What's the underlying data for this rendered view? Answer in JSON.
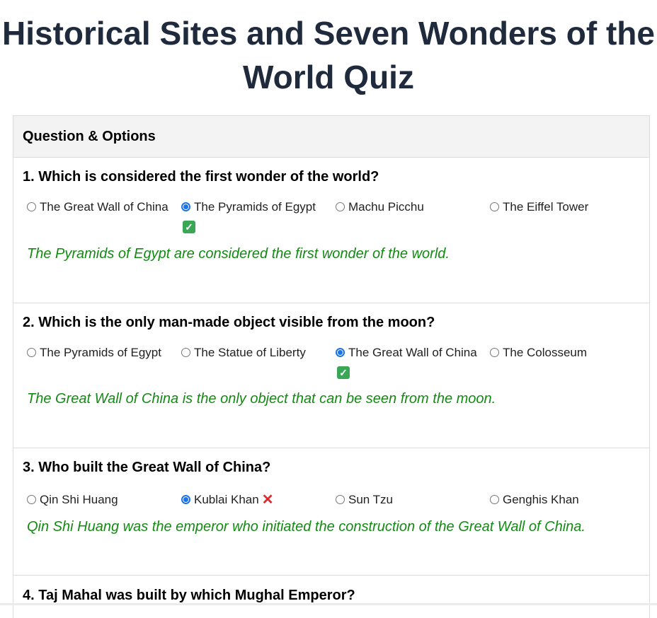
{
  "title": "Historical Sites and Seven Wonders of the World Quiz",
  "table": {
    "header": "Question & Options"
  },
  "questions": [
    {
      "text": "1. Which is considered the first wonder of the world?",
      "options": [
        "The Great Wall of China",
        "The Pyramids of Egypt",
        "Machu Picchu",
        "The Eiffel Tower"
      ],
      "selected": 1,
      "result_mark": "✅",
      "explanation": "The Pyramids of Egypt are considered the first wonder of the world."
    },
    {
      "text": "2. Which is the only man-made object visible from the moon?",
      "options": [
        "The Pyramids of Egypt",
        "The Statue of Liberty",
        "The Great Wall of China",
        "The Colosseum"
      ],
      "selected": 2,
      "result_mark": "✅",
      "explanation": "The Great Wall of China is the only object that can be seen from the moon."
    },
    {
      "text": "3. Who built the Great Wall of China?",
      "options": [
        "Qin Shi Huang",
        "Kublai Khan",
        "Sun Tzu",
        "Genghis Khan"
      ],
      "selected": 1,
      "result_mark": "❌",
      "explanation": "Qin Shi Huang was the emperor who initiated the construction of the Great Wall of China."
    },
    {
      "text": "4. Taj Mahal was built by which Mughal Emperor?"
    }
  ],
  "colors": {
    "title": "#1f2a3c",
    "explanation": "#138a13",
    "radio_selected": "#1a73e8",
    "wrong": "#e0282e",
    "correct": "#3aa757"
  }
}
